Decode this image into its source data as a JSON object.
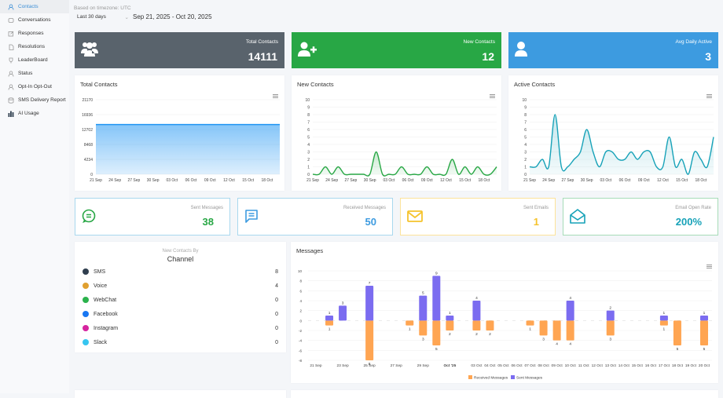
{
  "sidebar": {
    "items": [
      {
        "label": "Contacts",
        "icon": "user-icon",
        "active": true
      },
      {
        "label": "Conversations",
        "icon": "conversations-icon"
      },
      {
        "label": "Responses",
        "icon": "edit-icon"
      },
      {
        "label": "Resolutions",
        "icon": "document-icon"
      },
      {
        "label": "LeaderBoard",
        "icon": "trophy-icon"
      },
      {
        "label": "Status",
        "icon": "user-icon"
      },
      {
        "label": "Opt-In Opt-Out",
        "icon": "user-icon"
      },
      {
        "label": "SMS Delivery Report",
        "icon": "database-icon"
      },
      {
        "label": "AI Usage",
        "icon": "bar-chart-icon"
      }
    ]
  },
  "header": {
    "timezone": "Based on timezone: UTC",
    "range": "Last 30 days",
    "dates": "Sep 21, 2025 - Oct 20, 2025"
  },
  "kpis": [
    {
      "label": "Total Contacts",
      "value": "14111",
      "color": "#59636c",
      "icon": "users-icon"
    },
    {
      "label": "New Contacts",
      "value": "12",
      "color": "#28a745",
      "icon": "user-plus-icon"
    },
    {
      "label": "Avg Daily Active",
      "value": "3",
      "color": "#3d9be0",
      "icon": "user-icon"
    }
  ],
  "stats": [
    {
      "label": "Sent Messages",
      "value": "38",
      "color": "#28a745",
      "border": "#a9d8ee",
      "icon": "chat-bubble-icon"
    },
    {
      "label": "Received Messages",
      "value": "50",
      "color": "#3d9be0",
      "border": "#a9d8ee",
      "icon": "message-icon"
    },
    {
      "label": "Sent Emails",
      "value": "1",
      "color": "#f5c32c",
      "border": "#fce39a",
      "icon": "envelope-icon"
    },
    {
      "label": "Email Open Rate",
      "value": "200%",
      "color": "#17a2b8",
      "border": "#a6dcb8",
      "icon": "envelope-open-icon"
    }
  ],
  "channels": {
    "subtitle": "New Contacts By",
    "title": "Channel",
    "items": [
      {
        "name": "SMS",
        "count": "8",
        "color": "#2f3e4e"
      },
      {
        "name": "Voice",
        "count": "4",
        "color": "#e0a030"
      },
      {
        "name": "WebChat",
        "count": "0",
        "color": "#2bb24c"
      },
      {
        "name": "Facebook",
        "count": "0",
        "color": "#1877f2"
      },
      {
        "name": "Instagram",
        "count": "0",
        "color": "#d6249f"
      },
      {
        "name": "Slack",
        "count": "0",
        "color": "#36c5f0"
      }
    ]
  },
  "chart_data": [
    {
      "type": "area",
      "title": "Total Contacts",
      "color": "#2196f3",
      "ylim": [
        0,
        21170
      ],
      "yticks": [
        "0",
        "4234",
        "8468",
        "12702",
        "16936",
        "21170"
      ],
      "xticks": [
        "21 Sep",
        "24 Sep",
        "27 Sep",
        "30 Sep",
        "03 Oct",
        "06 Oct",
        "09 Oct",
        "12 Oct",
        "15 Oct",
        "18 Oct"
      ],
      "values": [
        14111,
        14111,
        14111,
        14111,
        14111,
        14111,
        14111,
        14111,
        14111,
        14111,
        14111,
        14111,
        14111,
        14111,
        14111,
        14111,
        14111,
        14111,
        14111,
        14111,
        14111,
        14111,
        14111,
        14111,
        14111,
        14111,
        14111,
        14111,
        14111,
        14111
      ]
    },
    {
      "type": "area",
      "title": "New Contacts",
      "color": "#28a745",
      "ylim": [
        0,
        10
      ],
      "yticks": [
        "0",
        "1",
        "2",
        "3",
        "4",
        "5",
        "6",
        "7",
        "8",
        "9",
        "10"
      ],
      "xticks": [
        "21 Sep",
        "24 Sep",
        "27 Sep",
        "30 Sep",
        "03 Oct",
        "06 Oct",
        "09 Oct",
        "12 Oct",
        "15 Oct",
        "18 Oct"
      ],
      "values": [
        0,
        0,
        1,
        0,
        1,
        0,
        0,
        0,
        0,
        0,
        3,
        0,
        0,
        0,
        1,
        0,
        0,
        0,
        1,
        0,
        0,
        0,
        2,
        0,
        1,
        0,
        1,
        0,
        0,
        1
      ]
    },
    {
      "type": "area",
      "title": "Active Contacts",
      "color": "#17a2b8",
      "ylim": [
        0,
        10
      ],
      "yticks": [
        "0",
        "1",
        "2",
        "3",
        "4",
        "5",
        "6",
        "7",
        "8",
        "9",
        "10"
      ],
      "xticks": [
        "21 Sep",
        "24 Sep",
        "27 Sep",
        "30 Sep",
        "03 Oct",
        "06 Oct",
        "09 Oct",
        "12 Oct",
        "15 Oct",
        "18 Oct"
      ],
      "values": [
        1,
        1,
        2,
        1,
        8,
        1,
        1,
        2,
        3,
        6,
        3,
        1,
        3,
        3,
        2,
        2,
        3,
        2,
        3,
        3,
        1,
        1,
        5,
        1,
        2,
        0,
        3,
        2,
        1,
        5
      ]
    },
    {
      "type": "bar",
      "title": "Messages",
      "ylim": [
        -8,
        10
      ],
      "yticks": [
        "-8",
        "-6",
        "-4",
        "-2",
        "0",
        "2",
        "4",
        "6",
        "8",
        "10"
      ],
      "tick_labels": [
        "21 Sep",
        "",
        "23 Sep",
        "",
        "25 Sep",
        "",
        "27 Sep",
        "",
        "29 Sep",
        "",
        "Oct '25",
        "",
        "03 Oct",
        "04 Oct",
        "05 Oct",
        "06 Oct",
        "07 Oct",
        "08 Oct",
        "09 Oct",
        "10 Oct",
        "11 Oct",
        "12 Oct",
        "13 Oct",
        "14 Oct",
        "15 Oct",
        "16 Oct",
        "17 Oct",
        "18 Oct",
        "19 Oct",
        "20 Oct"
      ],
      "series": [
        {
          "name": "Received Messages",
          "color": "#ffa552",
          "values": [
            0,
            -1,
            0,
            0,
            -8,
            0,
            0,
            -1,
            -3,
            -5,
            -2,
            0,
            -2,
            -2,
            0,
            0,
            -1,
            -3,
            -4,
            -4,
            0,
            0,
            -3,
            0,
            0,
            0,
            -1,
            -5,
            0,
            -5
          ]
        },
        {
          "name": "Sent Messages",
          "color": "#7b6cf0",
          "values": [
            0,
            1,
            3,
            0,
            7,
            0,
            0,
            0,
            5,
            9,
            1,
            0,
            4,
            0,
            0,
            0,
            0,
            0,
            0,
            4,
            0,
            0,
            2,
            0,
            0,
            0,
            1,
            0,
            0,
            1
          ]
        }
      ]
    }
  ]
}
